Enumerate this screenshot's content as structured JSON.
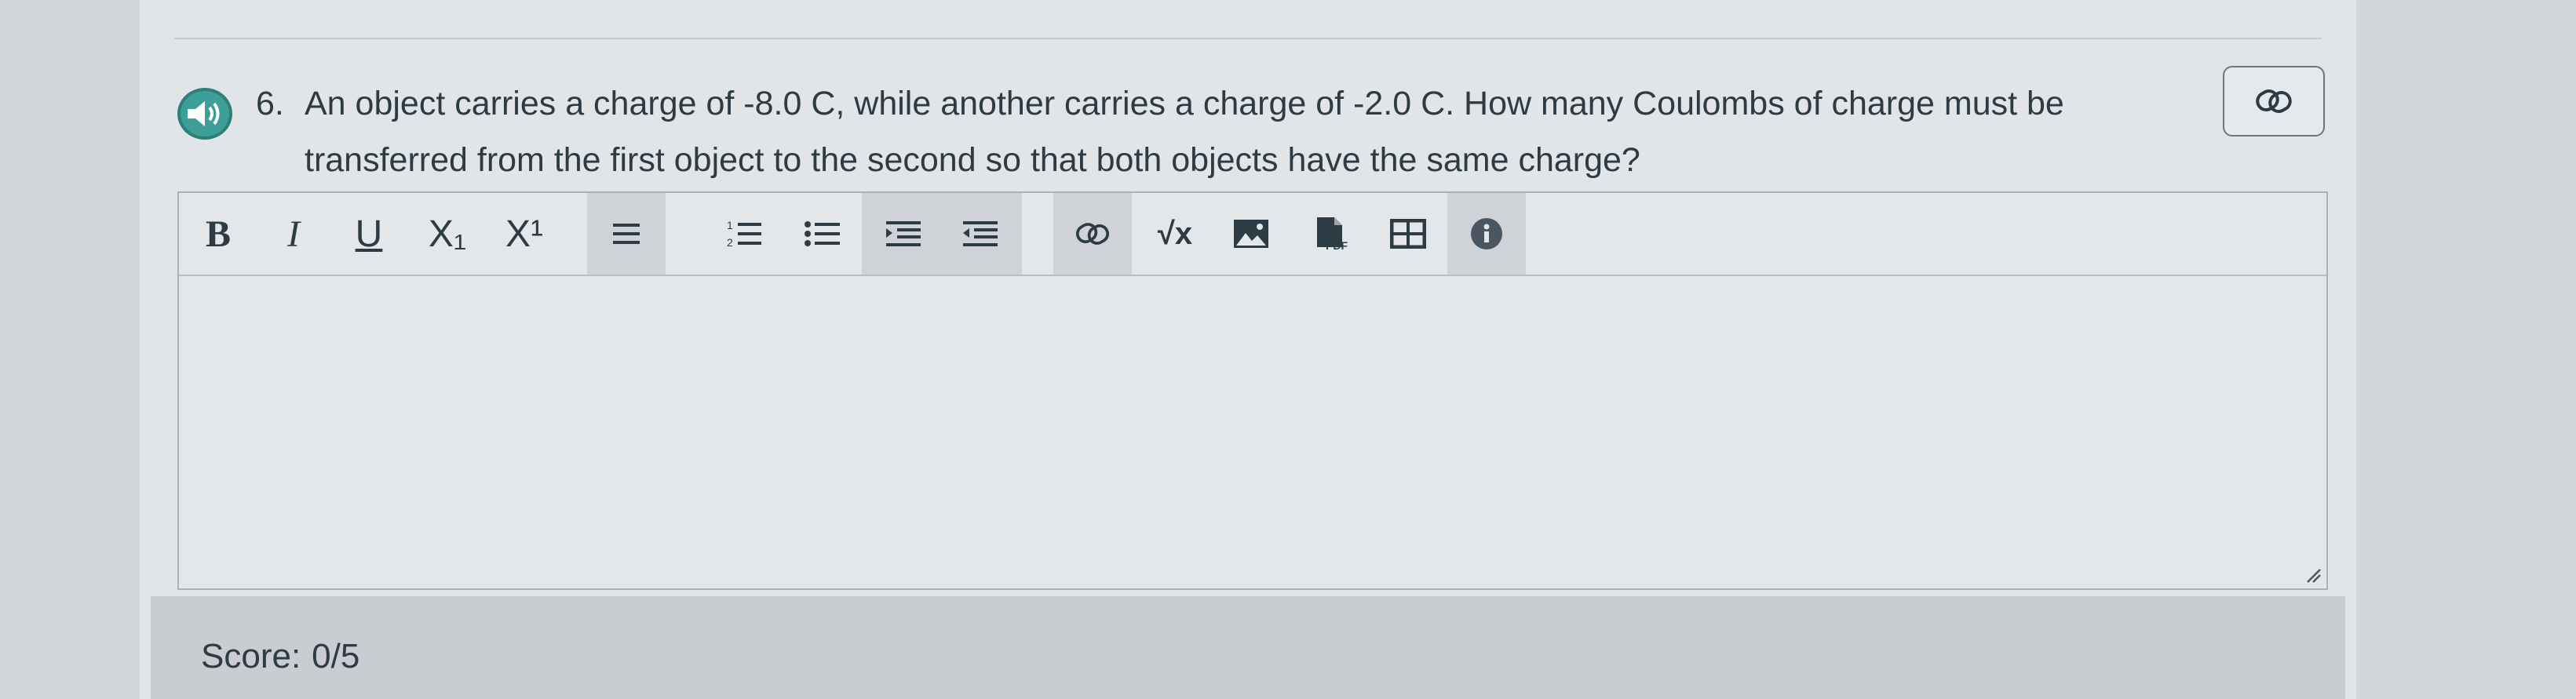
{
  "question": {
    "number": "6.",
    "text": "An object carries a charge of -8.0 C, while another carries a charge of -2.0 C. How many Coulombs of charge must be transferred from the first object to the second so that both objects have the same charge?"
  },
  "toolbar": {
    "bold": "B",
    "italic": "I",
    "underline": "U",
    "subscript": "X₁",
    "superscript": "X¹",
    "equation": "√x",
    "pdf": "PDF"
  },
  "score": {
    "label": "Score:",
    "value": "0/5"
  },
  "colors": {
    "accent": "#3e9f98",
    "text": "#2d3b45"
  }
}
